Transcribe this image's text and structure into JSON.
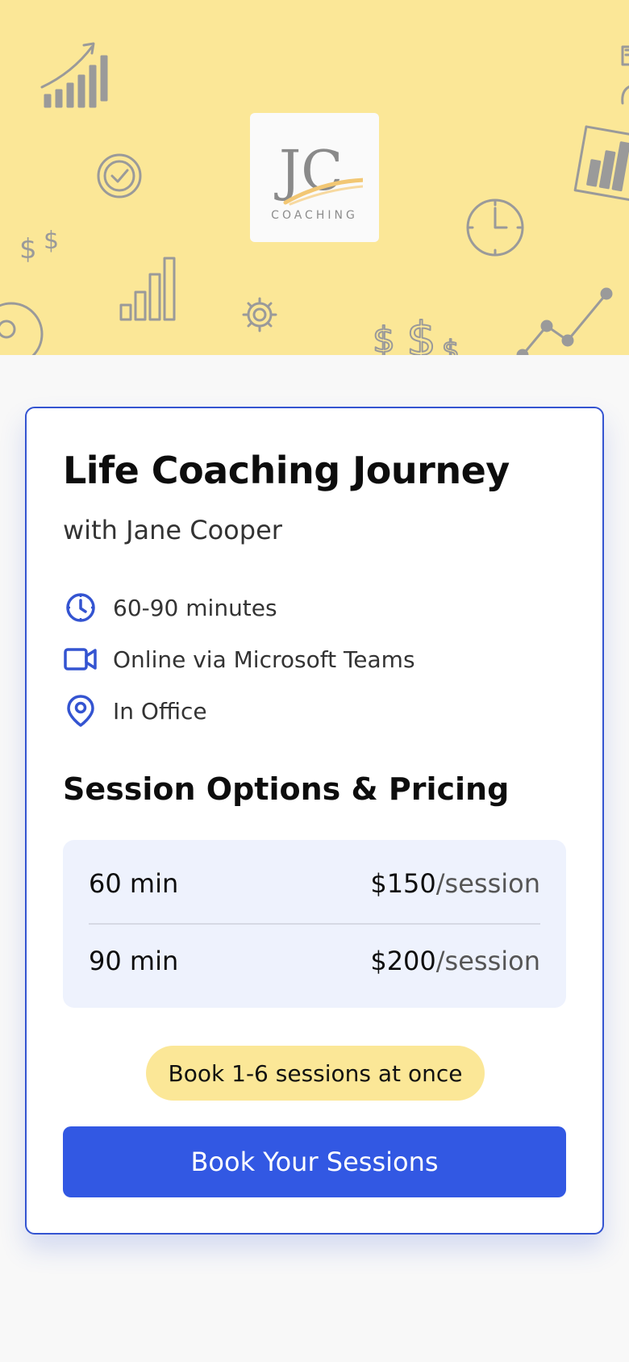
{
  "brand": {
    "logo_initials": "JC",
    "logo_word": "COACHING",
    "hero_color": "#fbe797"
  },
  "card": {
    "title": "Life Coaching Journey",
    "subtitle": "with Jane Cooper",
    "details": [
      {
        "icon": "clock-icon",
        "text": "60-90 minutes"
      },
      {
        "icon": "video-camera-icon",
        "text": "Online via Microsoft Teams"
      },
      {
        "icon": "location-pin-icon",
        "text": "In Office"
      }
    ],
    "pricing_title": "Session Options & Pricing",
    "pricing": [
      {
        "duration": "60 min",
        "price": "$150",
        "unit": "/session"
      },
      {
        "duration": "90 min",
        "price": "$200",
        "unit": "/session"
      }
    ],
    "badge": "Book 1-6 sessions at once",
    "cta_label": "Book Your Sessions"
  },
  "colors": {
    "accent": "#3258e3",
    "border": "#3454d1",
    "pricing_bg": "#eef2fd"
  }
}
